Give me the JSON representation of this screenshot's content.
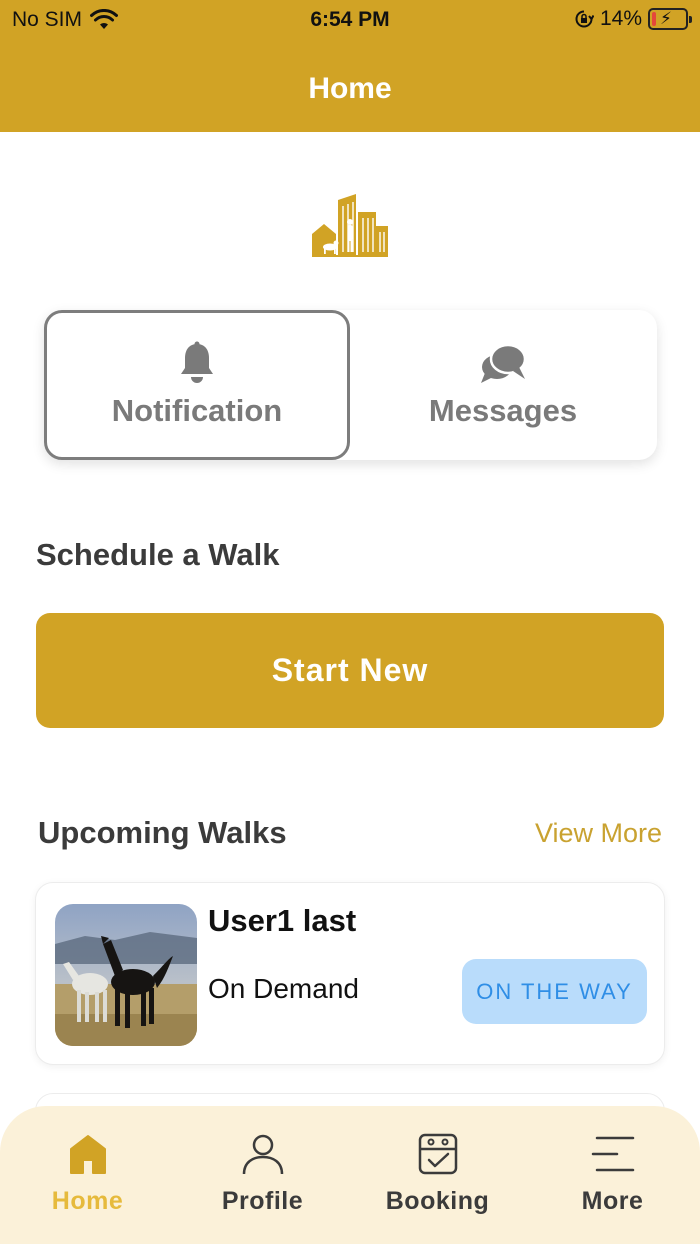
{
  "status_bar": {
    "carrier": "No SIM",
    "time": "6:54 PM",
    "battery_percent": "14%",
    "battery_level": 0.14,
    "icons": [
      "wifi-icon",
      "orientation-lock-icon",
      "battery-charging-icon"
    ]
  },
  "header": {
    "title": "Home"
  },
  "logo": {
    "icon": "building-dog-walker-logo"
  },
  "segmented": {
    "items": [
      {
        "label": "Notification",
        "icon": "bell-icon",
        "selected": true
      },
      {
        "label": "Messages",
        "icon": "chat-bubbles-icon",
        "selected": false
      }
    ]
  },
  "schedule": {
    "title": "Schedule a Walk",
    "button_label": "Start New"
  },
  "upcoming": {
    "title": "Upcoming Walks",
    "view_more": "View More",
    "walks": [
      {
        "name": "User1 last",
        "type": "On Demand",
        "status": "ON THE WAY",
        "photo": "horses-photo"
      }
    ]
  },
  "tabbar": {
    "tabs": [
      {
        "label": "Home",
        "icon": "home-icon",
        "active": true
      },
      {
        "label": "Profile",
        "icon": "person-icon",
        "active": false
      },
      {
        "label": "Booking",
        "icon": "calendar-check-icon",
        "active": false
      },
      {
        "label": "More",
        "icon": "menu-icon",
        "active": false
      }
    ]
  },
  "colors": {
    "brand": "#d1a325",
    "tab_active": "#e6ba3c",
    "status_bg": "#b9dcfb",
    "status_text": "#2f8ee6",
    "tabbar_bg": "#fbf1d9"
  }
}
